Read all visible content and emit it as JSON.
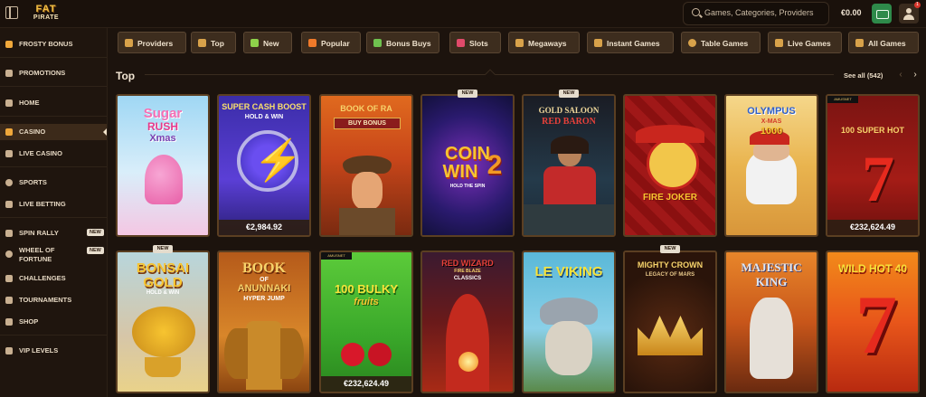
{
  "header": {
    "logo_top": "FAT",
    "logo_bottom": "PIRATE",
    "search_placeholder": "Games, Categories, Providers",
    "balance": "€0.00",
    "notification_count": "1"
  },
  "sidebar": {
    "items": [
      {
        "label": "FROSTY BONUS"
      },
      {
        "label": "PROMOTIONS"
      },
      {
        "label": "HOME"
      },
      {
        "label": "CASINO"
      },
      {
        "label": "LIVE CASINO"
      },
      {
        "label": "SPORTS"
      },
      {
        "label": "LIVE BETTING"
      },
      {
        "label": "SPIN RALLY",
        "badge": "NEW"
      },
      {
        "label": "WHEEL OF FORTUNE",
        "line1": "WHEEL OF",
        "line2": "FORTUNE",
        "badge": "NEW"
      },
      {
        "label": "CHALLENGES"
      },
      {
        "label": "TOURNAMENTS"
      },
      {
        "label": "SHOP"
      },
      {
        "label": "VIP LEVELS"
      }
    ]
  },
  "categories": [
    {
      "label": "Providers"
    },
    {
      "label": "Top"
    },
    {
      "label": "New"
    },
    {
      "label": "Popular"
    },
    {
      "label": "Bonus Buys"
    },
    {
      "label": "Slots"
    },
    {
      "label": "Megaways"
    },
    {
      "label": "Instant Games"
    },
    {
      "label": "Table Games"
    },
    {
      "label": "Live Games"
    },
    {
      "label": "All Games"
    }
  ],
  "section": {
    "title": "Top",
    "see_all": "See all (542)",
    "prev_arrow": "‹",
    "next_arrow": "›"
  },
  "games": [
    {
      "title": "Sugar Rush Xmas",
      "t1": "Sugar",
      "t2": "RUSH",
      "t3": "Xmas"
    },
    {
      "title": "Super Cash Boost Hold & Win",
      "t1": "SUPER CASH BOOST",
      "t2": "HOLD & WIN",
      "jackpot": "€2,984.92"
    },
    {
      "title": "Book of Ra Buy Bonus",
      "t1": "BOOK OF RA",
      "t2": "BUY BONUS"
    },
    {
      "title": "Coin Win 2 Hold the Spin",
      "t1": "COIN",
      "t2": "WIN",
      "t3": "2",
      "t4": "HOLD THE SPIN",
      "badge": "NEW"
    },
    {
      "title": "Gold Saloon Red Baron",
      "t1": "GOLD SALOON",
      "t2": "RED BARON",
      "badge": "NEW"
    },
    {
      "title": "Fire Joker",
      "t1": "FIRE JOKER"
    },
    {
      "title": "Gates of Olympus X-mas 1000",
      "t1": "OLYMPUS",
      "t2": "X-MAS",
      "t3": "1000"
    },
    {
      "title": "100 Super Hot",
      "t1": "100 SUPER HOT",
      "t2": "7",
      "jackpot": "€232,624.49",
      "provider": "AMUSNET"
    },
    {
      "title": "Bonsai Gold Hold & Win",
      "t1": "BONSAI",
      "t2": "GOLD",
      "t3": "HOLD & WIN",
      "badge": "NEW"
    },
    {
      "title": "Book of Anunnaki Hyper Jump",
      "t1": "BOOK",
      "t2": "OF",
      "t3": "ANUNNAKI",
      "t4": "HYPER JUMP"
    },
    {
      "title": "100 Bulky Fruits",
      "t1": "100 BULKY",
      "t2": "fruits",
      "jackpot": "€232,624.49",
      "provider": "AMUSNET"
    },
    {
      "title": "Red Wizard Fire Blaze Classics",
      "t1": "RED WIZARD",
      "t2": "FIRE BLAZE",
      "t3": "CLASSICS"
    },
    {
      "title": "Le Viking",
      "t1": "LE VIKING"
    },
    {
      "title": "Mighty Crown Legacy of Mars",
      "t1": "MIGHTY CROWN",
      "t2": "LEGACY OF MARS",
      "badge": "NEW"
    },
    {
      "title": "Majestic King",
      "t1": "MAJESTIC",
      "t2": "KING"
    },
    {
      "title": "Wild Hot 40",
      "t1": "WILD HOT 40",
      "t2": "7"
    }
  ],
  "colors": {
    "background": "#1c130d",
    "sidebar": "#1f150e",
    "accent": "#f0a83b",
    "button": "#3d2d1e"
  }
}
